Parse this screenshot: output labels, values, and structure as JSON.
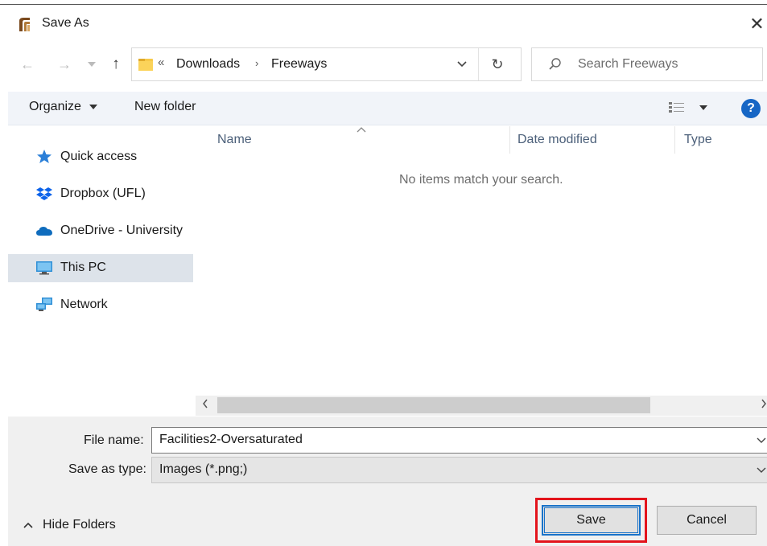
{
  "window": {
    "title": "Save As",
    "close_glyph": "✕"
  },
  "navigation": {
    "back_glyph": "←",
    "forward_glyph": "→",
    "recent_glyph": "⌄",
    "up_glyph": "↑"
  },
  "address": {
    "overflow_glyph": "«",
    "crumbs": [
      "Downloads",
      "Freeways"
    ],
    "separator": "›",
    "refresh_glyph": "↻"
  },
  "search": {
    "placeholder": "Search Freeways"
  },
  "toolbar": {
    "organize_label": "Organize",
    "new_folder_label": "New folder",
    "help_glyph": "?"
  },
  "sidebar": {
    "items": [
      {
        "label": "Quick access",
        "icon": "star-icon"
      },
      {
        "label": "Dropbox (UFL)",
        "icon": "dropbox-icon"
      },
      {
        "label": "OneDrive - University",
        "icon": "cloud-icon"
      },
      {
        "label": "This PC",
        "icon": "monitor-icon",
        "selected": true
      },
      {
        "label": "Network",
        "icon": "network-icon"
      }
    ]
  },
  "file_list": {
    "columns": [
      "Name",
      "Date modified",
      "Type"
    ],
    "empty_message": "No items match your search."
  },
  "form": {
    "file_name_label": "File name:",
    "file_name_value": "Facilities2-Oversaturated",
    "save_type_label": "Save as type:",
    "save_type_value": "Images (*.png;)"
  },
  "footer": {
    "hide_folders_label": "Hide Folders",
    "save_label": "Save",
    "cancel_label": "Cancel"
  },
  "colors": {
    "accent": "#1a73c9",
    "highlight_box": "#e3141c",
    "help": "#1666c5"
  }
}
